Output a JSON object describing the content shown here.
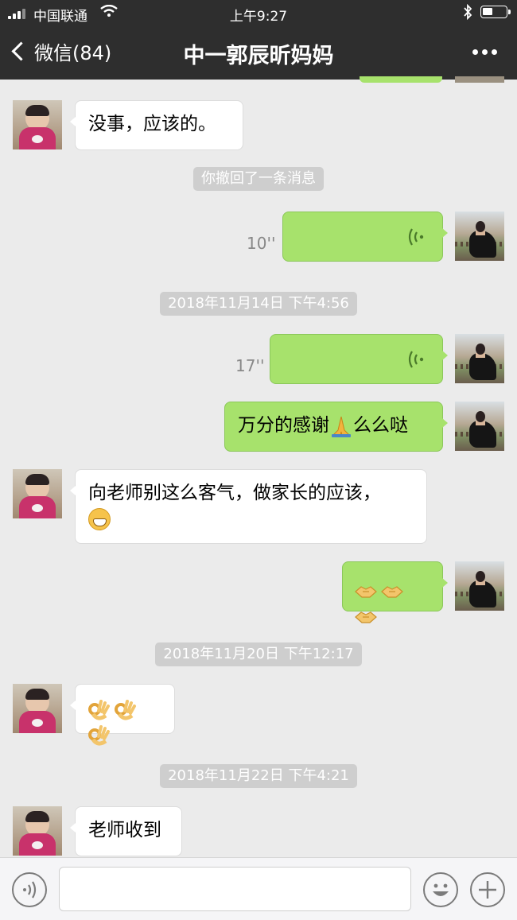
{
  "status_bar": {
    "carrier": "中国联通",
    "time": "上午9:27"
  },
  "nav": {
    "back_label": "微信(84)",
    "title": "中一郭辰昕妈妈"
  },
  "messages": {
    "m1": "没事，应该的。",
    "recall": "你撤回了一条消息",
    "voice1_duration": "10''",
    "ts1": "2018年11月14日 下午4:56",
    "voice2_duration": "17''",
    "m2": "万分的感谢",
    "m2b": "么么哒",
    "m3": "向老师别这么客气，做家长的应该，",
    "ts2": "2018年11月20日 下午12:17",
    "ts3": "2018年11月22日 下午4:21",
    "m4": "老师收到"
  },
  "colors": {
    "sent_bubble": "#a7e26c",
    "received_bubble": "#ffffff",
    "nav_bg": "#2e2e2e",
    "chat_bg": "#ebebeb"
  },
  "icons": [
    "back-chevron-icon",
    "more-dots-icon",
    "voice-wave-icon",
    "voice-input-icon",
    "emoji-icon",
    "plus-icon",
    "pray-emoji",
    "grin-emoji",
    "handshake-emoji",
    "ok-hand-emoji"
  ]
}
